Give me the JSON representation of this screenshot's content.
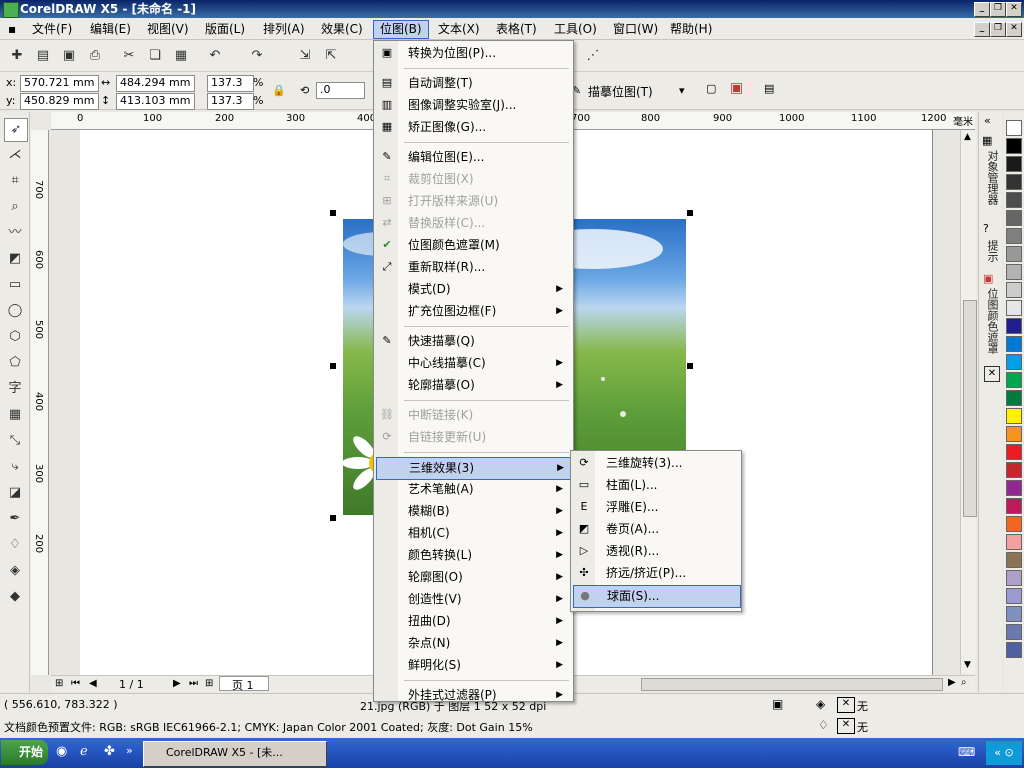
{
  "window": {
    "title": "CorelDRAW X5 - [未命名 -1]"
  },
  "menubar": [
    {
      "label": "文件(F)"
    },
    {
      "label": "编辑(E)"
    },
    {
      "label": "视图(V)"
    },
    {
      "label": "版面(L)"
    },
    {
      "label": "排列(A)"
    },
    {
      "label": "效果(C)"
    },
    {
      "label": "位图(B)"
    },
    {
      "label": "文本(X)"
    },
    {
      "label": "表格(T)"
    },
    {
      "label": "工具(O)"
    },
    {
      "label": "窗口(W)"
    },
    {
      "label": "帮助(H)"
    }
  ],
  "propbar": {
    "x_label": "x:",
    "x_val": "570.721 mm",
    "y_label": "y:",
    "y_val": "450.829 mm",
    "w_val": "484.294 mm",
    "h_val": "413.103 mm",
    "sx_val": "137.3",
    "sy_val": "137.3",
    "pct": "%",
    "rot_val": ".0",
    "trace_label": "描摹位图(T)"
  },
  "ruler": {
    "h_ticks": [
      "300",
      "400",
      "700",
      "800",
      "900",
      "1000",
      "1100",
      "1200"
    ],
    "h_ticks_left": [
      "0",
      "100",
      "200"
    ],
    "h_unit": "毫米",
    "v_ticks": [
      "700",
      "600",
      "500",
      "400",
      "300",
      "200"
    ]
  },
  "bitmap_menu": {
    "items": [
      {
        "label": "转换为位图(P)...",
        "icon": "convert-icon",
        "disabled": false,
        "arrow": false
      },
      {
        "label": "自动调整(T)",
        "icon": "auto-adjust-icon",
        "disabled": false,
        "arrow": false
      },
      {
        "label": "图像调整实验室(J)...",
        "icon": "lab-icon",
        "disabled": false,
        "arrow": false
      },
      {
        "label": "矫正图像(G)...",
        "icon": "straighten-icon",
        "disabled": false,
        "arrow": false
      },
      {
        "label": "编辑位图(E)...",
        "icon": "edit-bitmap-icon",
        "disabled": false,
        "arrow": false
      },
      {
        "label": "裁剪位图(X)",
        "icon": "crop-icon",
        "disabled": true,
        "arrow": false
      },
      {
        "label": "打开版样来源(U)",
        "icon": "open-source-icon",
        "disabled": true,
        "arrow": false
      },
      {
        "label": "替换版样(C)...",
        "icon": "replace-icon",
        "disabled": true,
        "arrow": false
      },
      {
        "label": "位图颜色遮罩(M)",
        "icon": "checkmark-icon",
        "disabled": false,
        "arrow": false
      },
      {
        "label": "重新取样(R)...",
        "icon": "resample-icon",
        "disabled": false,
        "arrow": false
      },
      {
        "label": "模式(D)",
        "icon": "",
        "disabled": false,
        "arrow": true
      },
      {
        "label": "扩充位图边框(F)",
        "icon": "",
        "disabled": false,
        "arrow": true
      },
      {
        "label": "快速描摹(Q)",
        "icon": "quick-trace-icon",
        "disabled": false,
        "arrow": false
      },
      {
        "label": "中心线描摹(C)",
        "icon": "",
        "disabled": false,
        "arrow": true
      },
      {
        "label": "轮廓描摹(O)",
        "icon": "",
        "disabled": false,
        "arrow": true
      },
      {
        "label": "中断链接(K)",
        "icon": "break-link-icon",
        "disabled": true,
        "arrow": false
      },
      {
        "label": "自链接更新(U)",
        "icon": "update-link-icon",
        "disabled": true,
        "arrow": false
      },
      {
        "label": "三维效果(3)",
        "icon": "",
        "disabled": false,
        "arrow": true,
        "highlight": true
      },
      {
        "label": "艺术笔触(A)",
        "icon": "",
        "disabled": false,
        "arrow": true
      },
      {
        "label": "模糊(B)",
        "icon": "",
        "disabled": false,
        "arrow": true
      },
      {
        "label": "相机(C)",
        "icon": "",
        "disabled": false,
        "arrow": true
      },
      {
        "label": "颜色转换(L)",
        "icon": "",
        "disabled": false,
        "arrow": true
      },
      {
        "label": "轮廓图(O)",
        "icon": "",
        "disabled": false,
        "arrow": true
      },
      {
        "label": "创造性(V)",
        "icon": "",
        "disabled": false,
        "arrow": true
      },
      {
        "label": "扭曲(D)",
        "icon": "",
        "disabled": false,
        "arrow": true
      },
      {
        "label": "杂点(N)",
        "icon": "",
        "disabled": false,
        "arrow": true
      },
      {
        "label": "鲜明化(S)",
        "icon": "",
        "disabled": false,
        "arrow": true
      },
      {
        "label": "外挂式过滤器(P)",
        "icon": "",
        "disabled": false,
        "arrow": true
      }
    ]
  },
  "submenu_3d": [
    {
      "label": "三维旋转(3)...",
      "icon": "rotate3d-icon"
    },
    {
      "label": "柱面(L)...",
      "icon": "cylinder-icon"
    },
    {
      "label": "浮雕(E)...",
      "icon": "emboss-icon"
    },
    {
      "label": "卷页(A)...",
      "icon": "page-curl-icon"
    },
    {
      "label": "透视(R)...",
      "icon": "perspective-icon"
    },
    {
      "label": "挤远/挤近(P)...",
      "icon": "pinch-punch-icon"
    },
    {
      "label": "球面(S)...",
      "icon": "sphere-icon",
      "highlight": true
    }
  ],
  "docker_tabs": [
    "对象管理器",
    "提示",
    "位图颜色遮罩"
  ],
  "palette": [
    "#ffffff",
    "#000000",
    "#1a1a1a",
    "#333333",
    "#4d4d4d",
    "#666666",
    "#808080",
    "#999999",
    "#b3b3b3",
    "#cccccc",
    "#e6e6e6",
    "#1e1e8c",
    "#0078d7",
    "#00a0e9",
    "#00a651",
    "#007a3d",
    "#fff200",
    "#f7941d",
    "#ed1c24",
    "#c1272d",
    "#92278f",
    "#c2185b",
    "#f26522",
    "#f5a0a0",
    "#8b7355",
    "#b0a0c8",
    "#9a9ad0",
    "#8090c0",
    "#6a7ab0",
    "#5060a0"
  ],
  "page_nav": {
    "page_count": "1 / 1",
    "page_tab": "页 1"
  },
  "status": {
    "coords": "( 556.610, 783.322 )",
    "object_info": "21.jpg (RGB) 于 图层 1 52 x 52 dpi",
    "fill_label": "无",
    "outline_label": "无",
    "color_profile": "文档颜色预置文件: RGB: sRGB IEC61966-2.1; CMYK: Japan Color 2001 Coated; 灰度: Dot Gain 15%"
  },
  "taskbar": {
    "start": "开始",
    "task": "CorelDRAW X5 - [未..."
  }
}
